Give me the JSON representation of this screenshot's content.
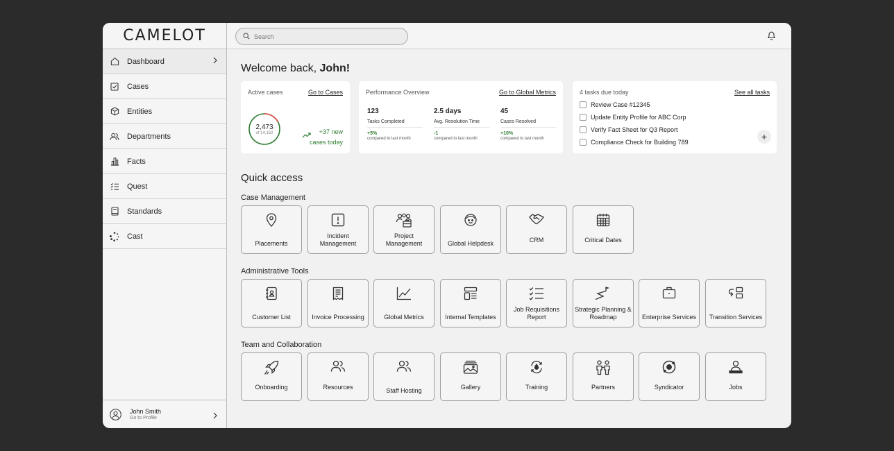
{
  "app": {
    "logo": "CAMELOT"
  },
  "search": {
    "placeholder": "Search"
  },
  "sidebar": {
    "items": [
      {
        "label": "Dashboard",
        "icon": "home-icon"
      },
      {
        "label": "Cases",
        "icon": "checkbox-icon"
      },
      {
        "label": "Entities",
        "icon": "cube-icon"
      },
      {
        "label": "Departments",
        "icon": "people-icon"
      },
      {
        "label": "Facts",
        "icon": "bar-chart-icon"
      },
      {
        "label": "Quest",
        "icon": "checklist-icon"
      },
      {
        "label": "Standards",
        "icon": "book-icon"
      },
      {
        "label": "Cast",
        "icon": "spinner-icon"
      }
    ],
    "profile": {
      "name": "John Smith",
      "sub": "Go to Profile"
    }
  },
  "welcome": {
    "prefix": "Welcome back, ",
    "name": "John!"
  },
  "active_cases": {
    "title": "Active cases",
    "link": "Go to Cases",
    "value": "2,473",
    "of": "of 14,162",
    "progress": 0.175,
    "trend_line1": "+37 new",
    "trend_line2": "cases today"
  },
  "performance": {
    "title": "Performance Overview",
    "link": "Go to Global Metrics",
    "metrics": [
      {
        "value": "123",
        "label": "Tasks Completed",
        "delta": "+5%",
        "compare": "compared to last month"
      },
      {
        "value": "2.5 days",
        "label": "Avg. Resolution Time",
        "delta": "-1",
        "compare": "compared to last month"
      },
      {
        "value": "45",
        "label": "Cases Resolved",
        "delta": "+10%",
        "compare": "compared to last month"
      }
    ]
  },
  "tasks": {
    "title": "4 tasks due today",
    "link": "See all tasks",
    "items": [
      "Review Case #12345",
      "Update Entity Profile for ABC Corp",
      "Verify Fact Sheet for Q3 Report",
      "Compliance Check for Building 789"
    ],
    "add": "+"
  },
  "quick_access": {
    "title": "Quick access",
    "sections": [
      {
        "title": "Case Management",
        "tiles": [
          {
            "label": "Placements",
            "icon": "location-pin-icon"
          },
          {
            "label": "Incident Management",
            "icon": "alert-icon"
          },
          {
            "label": "Project Management",
            "icon": "team-briefcase-icon"
          },
          {
            "label": "Global Helpdesk",
            "icon": "headset-icon"
          },
          {
            "label": "CRM",
            "icon": "handshake-icon"
          },
          {
            "label": "Critical Dates",
            "icon": "calendar-icon"
          }
        ]
      },
      {
        "title": "Administrative Tools",
        "tiles": [
          {
            "label": "Customer List",
            "icon": "contact-book-icon"
          },
          {
            "label": "Invoice Processing",
            "icon": "receipt-icon"
          },
          {
            "label": "Global Metrics",
            "icon": "line-chart-icon"
          },
          {
            "label": "Internal Templates",
            "icon": "template-icon"
          },
          {
            "label": "Job Requisitions Report",
            "icon": "checklist-icon"
          },
          {
            "label": "Strategic Planning & Roadmap",
            "icon": "roadmap-icon"
          },
          {
            "label": "Enterprise Services",
            "icon": "briefcase-icon"
          },
          {
            "label": "Transition Services",
            "icon": "transition-icon"
          }
        ]
      },
      {
        "title": "Team and Collaboration",
        "tiles": [
          {
            "label": "Onboarding",
            "icon": "rocket-icon"
          },
          {
            "label": "Resources",
            "icon": "people-icon"
          },
          {
            "label": "Staff Hosting",
            "icon": "people-icon"
          },
          {
            "label": "Gallery",
            "icon": "gallery-icon"
          },
          {
            "label": "Training",
            "icon": "training-icon"
          },
          {
            "label": "Partners",
            "icon": "partners-icon"
          },
          {
            "label": "Syndicator",
            "icon": "syndicator-icon"
          },
          {
            "label": "Jobs",
            "icon": "user-desk-icon"
          }
        ]
      }
    ]
  }
}
